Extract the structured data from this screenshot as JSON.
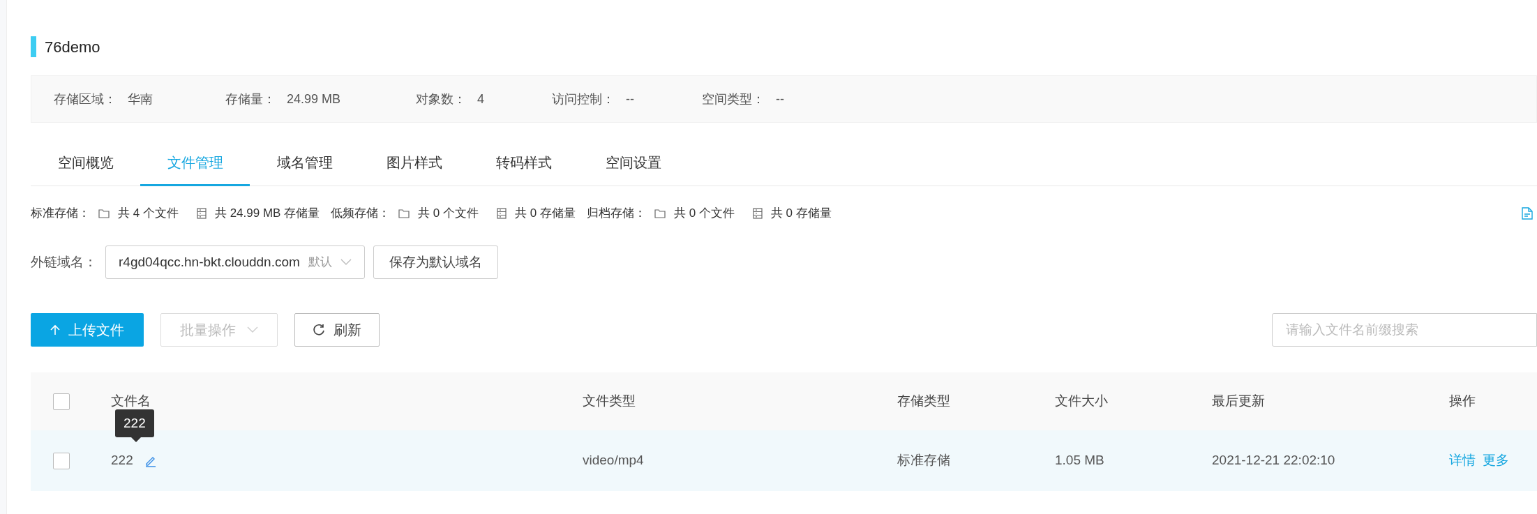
{
  "bucket": {
    "title": "76demo"
  },
  "info": [
    {
      "label": "存储区域：",
      "value": "华南"
    },
    {
      "label": "存储量：",
      "value": "24.99 MB"
    },
    {
      "label": "对象数：",
      "value": "4"
    },
    {
      "label": "访问控制：",
      "value": "--"
    },
    {
      "label": "空间类型：",
      "value": "--"
    }
  ],
  "tabs": [
    {
      "label": "空间概览",
      "selected": false
    },
    {
      "label": "文件管理",
      "selected": true
    },
    {
      "label": "域名管理",
      "selected": false
    },
    {
      "label": "图片样式",
      "selected": false
    },
    {
      "label": "转码样式",
      "selected": false
    },
    {
      "label": "空间设置",
      "selected": false
    }
  ],
  "storage_summary": [
    {
      "label": "标准存储：",
      "files": "共 4 个文件",
      "size": "共 24.99 MB 存储量"
    },
    {
      "label": "低频存储：",
      "files": "共 0 个文件",
      "size": "共 0 存储量"
    },
    {
      "label": "归档存储：",
      "files": "共 0 个文件",
      "size": "共 0 存储量"
    }
  ],
  "domain": {
    "label": "外链域名：",
    "value": "r4gd04qcc.hn-bkt.clouddn.com",
    "tag": "默认",
    "save_button": "保存为默认域名"
  },
  "toolbar": {
    "upload": "上传文件",
    "batch": "批量操作",
    "refresh": "刷新",
    "search_placeholder": "请输入文件名前缀搜索"
  },
  "table": {
    "select_all": {
      "checked": false
    },
    "columns": [
      "文件名",
      "文件类型",
      "存储类型",
      "文件大小",
      "最后更新",
      "操作"
    ],
    "rows": [
      {
        "checked": false,
        "name": "222",
        "type": "video/mp4",
        "storage": "标准存储",
        "size": "1.05 MB",
        "updated": "2021-12-21 22:02:10",
        "actions": [
          "详情",
          "更多"
        ],
        "tooltip": "222"
      }
    ]
  }
}
